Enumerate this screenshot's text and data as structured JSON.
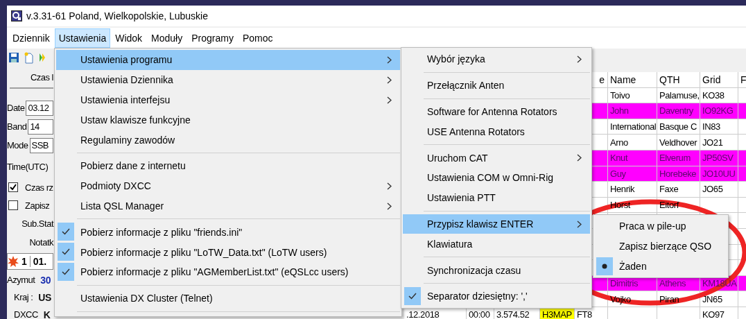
{
  "window": {
    "title": "v.3.31-61 Poland, Wielkopolskie, Lubuskie"
  },
  "menu_bar": [
    {
      "label": "Dziennik",
      "selected": false
    },
    {
      "label": "Ustawienia",
      "selected": true
    },
    {
      "label": "Widok",
      "selected": false
    },
    {
      "label": "Moduły",
      "selected": false
    },
    {
      "label": "Programy",
      "selected": false
    },
    {
      "label": "Pomoc",
      "selected": false
    }
  ],
  "left_panel": {
    "header": "Czas l",
    "fields": [
      {
        "label": "Date",
        "value": "03.12"
      },
      {
        "label": "Band",
        "value": "14"
      },
      {
        "label": "Mode",
        "value": "SSB"
      }
    ],
    "time_label": "Time(UTC)",
    "checkboxes": [
      {
        "label": "Czas rz",
        "checked": true
      },
      {
        "label": "Zapisz",
        "checked": false
      }
    ],
    "labels": [
      "Sub.Stat",
      "Notatk"
    ],
    "qso_row": {
      "number": "1",
      "date": "01."
    },
    "info": [
      {
        "kind": "bearing",
        "label": "Azymut",
        "value": "30"
      },
      {
        "kind": "text",
        "label": "Kraj :",
        "value": "US"
      },
      {
        "kind": "text",
        "label": "DXCC",
        "value": "K"
      }
    ]
  },
  "table": {
    "columns": [
      null,
      null,
      null,
      null,
      "e",
      "Name",
      "QTH",
      "Grid",
      "F"
    ],
    "rows": [
      {
        "cells": [
          null,
          null,
          null,
          null,
          null,
          "Toivo",
          "Palamuse,",
          "KO38",
          null
        ]
      },
      {
        "color": "#ff00ff",
        "cells": [
          null,
          null,
          null,
          null,
          null,
          "John",
          "Daventry",
          "IO92KG",
          null
        ]
      },
      {
        "cells": [
          null,
          null,
          null,
          null,
          null,
          "International",
          "Basque C",
          "IN83",
          null
        ]
      },
      {
        "cells": [
          null,
          null,
          null,
          null,
          null,
          "Arno",
          "Veldhover",
          "JO21",
          null
        ]
      },
      {
        "color": "#ff00ff",
        "cells": [
          null,
          null,
          null,
          null,
          null,
          "Knut",
          "Elverum",
          "JP50SV",
          null
        ]
      },
      {
        "color": "#ff00ff",
        "cells": [
          null,
          null,
          null,
          null,
          null,
          "Guy",
          "Horebeke",
          "JO10UU",
          null
        ]
      },
      {
        "cells": [
          null,
          null,
          null,
          null,
          null,
          "Henrik",
          "Faxe",
          "JO65",
          null
        ]
      },
      {
        "cells": [
          null,
          null,
          null,
          null,
          null,
          "Horst",
          "Eitorf",
          null,
          null
        ]
      },
      {
        "cells": [
          null,
          null,
          null,
          null,
          null,
          null,
          null,
          null,
          null
        ]
      },
      {
        "cells": [
          null,
          null,
          null,
          null,
          null,
          null,
          null,
          null,
          null
        ]
      },
      {
        "cells": [
          null,
          null,
          null,
          null,
          null,
          null,
          null,
          null,
          null
        ]
      },
      {
        "cells": [
          null,
          null,
          null,
          null,
          null,
          null,
          null,
          null,
          null
        ]
      },
      {
        "color": "#ff00ff",
        "cells": [
          null,
          null,
          null,
          null,
          null,
          "Dimitris",
          "Athens",
          "KM18UA",
          null
        ]
      },
      {
        "cells": [
          null,
          null,
          null,
          null,
          null,
          "Vojko",
          "Piran",
          "JN65",
          null
        ]
      },
      {
        "cells": [
          ".12.2018",
          "00:00",
          "3.574.52",
          {
            "text": "H3MAP",
            "color": "#ffff00"
          },
          "FT8",
          null,
          null,
          "KO97",
          null
        ]
      }
    ]
  },
  "menus": [
    {
      "items": [
        {
          "kind": "check_item",
          "label": "Ustawienia programu",
          "submenu": true,
          "selected": true,
          "checked": false
        },
        {
          "kind": "check_item",
          "label": "Ustawienia Dziennika",
          "submenu": true,
          "selected": false,
          "checked": false
        },
        {
          "kind": "check_item",
          "label": "Ustawienia interfejsu",
          "submenu": true,
          "selected": false,
          "checked": false
        },
        {
          "kind": "check_item",
          "label": "Ustaw klawisze funkcyjne",
          "submenu": false,
          "selected": false,
          "checked": false
        },
        {
          "kind": "check_item",
          "label": "Regulaminy zawodów",
          "submenu": false,
          "selected": false,
          "checked": false
        },
        {
          "kind": "separator"
        },
        {
          "kind": "check_item",
          "label": "Pobierz dane z internetu",
          "submenu": false,
          "selected": false,
          "checked": false
        },
        {
          "kind": "check_item",
          "label": "Podmioty DXCC",
          "submenu": true,
          "selected": false,
          "checked": false
        },
        {
          "kind": "check_item",
          "label": "Lista QSL Manager",
          "submenu": true,
          "selected": false,
          "checked": false
        },
        {
          "kind": "separator"
        },
        {
          "kind": "check_item",
          "label": "Pobierz informacje z pliku \"friends.ini\"",
          "submenu": false,
          "selected": false,
          "checked": true
        },
        {
          "kind": "check_item",
          "label": "Pobierz informacje z pliku \"LoTW_Data.txt\" (LoTW users)",
          "submenu": false,
          "selected": false,
          "checked": true
        },
        {
          "kind": "check_item",
          "label": "Pobierz informacje z pliku \"AGMemberList.txt\" (eQSLcc users)",
          "submenu": false,
          "selected": false,
          "checked": true
        },
        {
          "kind": "separator"
        },
        {
          "kind": "check_item",
          "label": "Ustawienia DX Cluster (Telnet)",
          "submenu": false,
          "selected": false,
          "checked": false
        },
        {
          "kind": "separator"
        }
      ]
    },
    {
      "items": [
        {
          "kind": "check_item",
          "label": "Wybór języka",
          "submenu": true,
          "selected": false,
          "checked": false
        },
        {
          "kind": "separator"
        },
        {
          "kind": "check_item",
          "label": "Przełącznik Anten",
          "submenu": false,
          "selected": false,
          "checked": false
        },
        {
          "kind": "separator"
        },
        {
          "kind": "check_item",
          "label": "Software for Antenna Rotators",
          "submenu": false,
          "selected": false,
          "checked": false
        },
        {
          "kind": "check_item",
          "label": "USE  Antenna Rotators",
          "submenu": false,
          "selected": false,
          "checked": false
        },
        {
          "kind": "separator"
        },
        {
          "kind": "check_item",
          "label": "Uruchom CAT",
          "submenu": true,
          "selected": false,
          "checked": false
        },
        {
          "kind": "check_item",
          "label": "Ustawienia COM w Omni-Rig",
          "submenu": false,
          "selected": false,
          "checked": false
        },
        {
          "kind": "check_item",
          "label": "Ustawienia PTT",
          "submenu": false,
          "selected": false,
          "checked": false
        },
        {
          "kind": "separator"
        },
        {
          "kind": "check_item",
          "label": "Przypisz klawisz ENTER",
          "submenu": true,
          "selected": true,
          "checked": false
        },
        {
          "kind": "check_item",
          "label": "Klawiatura",
          "submenu": false,
          "selected": false,
          "checked": false
        },
        {
          "kind": "separator"
        },
        {
          "kind": "check_item",
          "label": "Synchronizacja czasu",
          "submenu": false,
          "selected": false,
          "checked": false
        },
        {
          "kind": "separator"
        },
        {
          "kind": "check_item",
          "label": "Separator dziesiętny: ','",
          "submenu": false,
          "selected": false,
          "checked": true
        }
      ]
    },
    {
      "items": [
        {
          "kind": "radio_item",
          "label": "Praca w pile-up",
          "submenu": false,
          "selected": false,
          "checked": false
        },
        {
          "kind": "radio_item",
          "label": "Zapisz bierzące QSO",
          "submenu": false,
          "selected": false,
          "checked": false
        },
        {
          "kind": "radio_item",
          "label": "Żaden",
          "submenu": false,
          "selected": false,
          "checked": true
        }
      ]
    }
  ]
}
